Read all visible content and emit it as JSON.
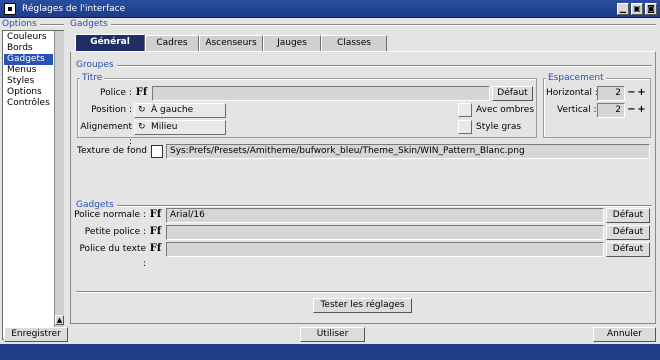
{
  "window": {
    "title": "Réglages de l'interface",
    "buttons": [
      "minimize",
      "depth",
      "close"
    ]
  },
  "sections": {
    "options_label": "Options",
    "gadgets_label": "Gadgets"
  },
  "options_list": [
    {
      "label": "Couleurs",
      "selected": false
    },
    {
      "label": "Bords",
      "selected": false
    },
    {
      "label": "Gadgets",
      "selected": true
    },
    {
      "label": "Menus",
      "selected": false
    },
    {
      "label": "Styles",
      "selected": false
    },
    {
      "label": "Options",
      "selected": false
    },
    {
      "label": "Contrôles",
      "selected": false
    }
  ],
  "tabs": [
    {
      "label": "Général",
      "active": true
    },
    {
      "label": "Cadres",
      "active": false
    },
    {
      "label": "Ascenseurs",
      "active": false
    },
    {
      "label": "Jauges",
      "active": false
    },
    {
      "label": "Classes",
      "active": false
    }
  ],
  "groupes": {
    "label": "Groupes",
    "titre": {
      "label": "Titre",
      "police_label": "Police :",
      "police_value": "",
      "police_default": "Défaut",
      "position_label": "Position :",
      "position_value": "À gauche",
      "alignement_label": "Alignement :",
      "alignement_value": "Milieu",
      "avec_ombres": "Avec ombres",
      "style_gras": "Style gras"
    },
    "espacement": {
      "label": "Espacement",
      "horizontal_label": "Horizontal :",
      "horizontal_value": "2",
      "vertical_label": "Vertical :",
      "vertical_value": "2"
    },
    "texture_label": "Texture de fond :",
    "texture_value": "Sys:Prefs/Presets/Amitheme/bufwork_bleu/Theme_Skin/WIN_Pattern_Blanc.png"
  },
  "gadgets": {
    "label": "Gadgets",
    "police_normale_label": "Police normale :",
    "police_normale_value": "Arial/16",
    "petite_police_label": "Petite police :",
    "petite_police_value": "",
    "police_texte_label": "Police du texte :",
    "police_texte_value": "",
    "default_label": "Défaut"
  },
  "ff_glyph": "Ff",
  "actions": {
    "test": "Tester les réglages",
    "save": "Enregistrer",
    "use": "Utiliser",
    "cancel": "Annuler"
  }
}
